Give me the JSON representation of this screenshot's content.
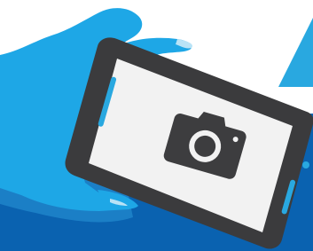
{
  "illustration": {
    "icons": [
      "hand-icon",
      "smartphone-icon",
      "camera-icon"
    ]
  },
  "colors": {
    "background": "#ffffff",
    "sky_blue": "#29a8e0",
    "dark_blue": "#0a62b0",
    "hand_blue": "#1ea7e6",
    "hand_shadow": "#1b7fc6",
    "phone_body": "#3b3b3d",
    "screen": "#f2f2f2",
    "camera": "#3d3d3f",
    "accent": "#29a8e0"
  }
}
